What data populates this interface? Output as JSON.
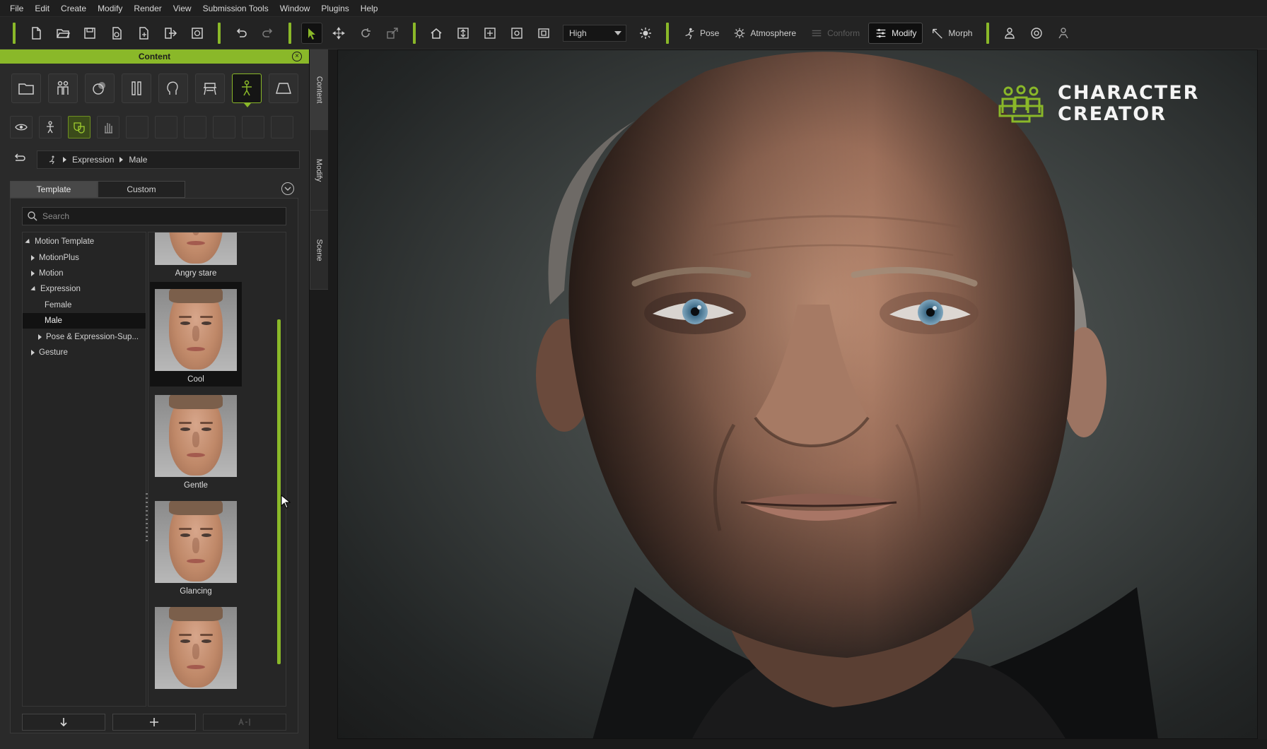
{
  "menubar": {
    "items": [
      "File",
      "Edit",
      "Create",
      "Modify",
      "Render",
      "View",
      "Submission Tools",
      "Window",
      "Plugins",
      "Help"
    ]
  },
  "toolbar": {
    "quality_value": "High",
    "buttons": [
      {
        "label": "Pose",
        "icon": "pose-icon"
      },
      {
        "label": "Atmosphere",
        "icon": "atmosphere-icon"
      },
      {
        "label": "Conform",
        "icon": "conform-icon",
        "disabled": true
      },
      {
        "label": "Modify",
        "icon": "modify-icon",
        "active": true
      },
      {
        "label": "Morph",
        "icon": "morph-icon"
      }
    ],
    "accent_color": "#8ab829"
  },
  "panel": {
    "title": "Content",
    "breadcrumb": [
      "Expression",
      "Male"
    ],
    "tabs": [
      {
        "label": "Template",
        "active": true
      },
      {
        "label": "Custom",
        "active": false
      }
    ],
    "search_placeholder": "Search",
    "tree": [
      {
        "label": "Motion Template",
        "level": 0,
        "expanded": true
      },
      {
        "label": "MotionPlus",
        "level": 1,
        "expanded": false
      },
      {
        "label": "Motion",
        "level": 1,
        "expanded": false
      },
      {
        "label": "Expression",
        "level": 1,
        "expanded": true
      },
      {
        "label": "Female",
        "level": 2
      },
      {
        "label": "Male",
        "level": 2,
        "selected": true
      },
      {
        "label": "Pose & Expression-Sup...",
        "level": 2,
        "expanded": false
      },
      {
        "label": "Gesture",
        "level": 1,
        "expanded": false
      }
    ],
    "thumbnails": [
      {
        "name": "Angry stare"
      },
      {
        "name": "Cool",
        "selected": true
      },
      {
        "name": "Gentle"
      },
      {
        "name": "Glancing"
      },
      {
        "name": ""
      }
    ]
  },
  "side_tabs": [
    "Content",
    "Modify",
    "Scene"
  ],
  "viewport": {
    "brand_line1": "CHARACTER",
    "brand_line2": "CREATOR"
  }
}
